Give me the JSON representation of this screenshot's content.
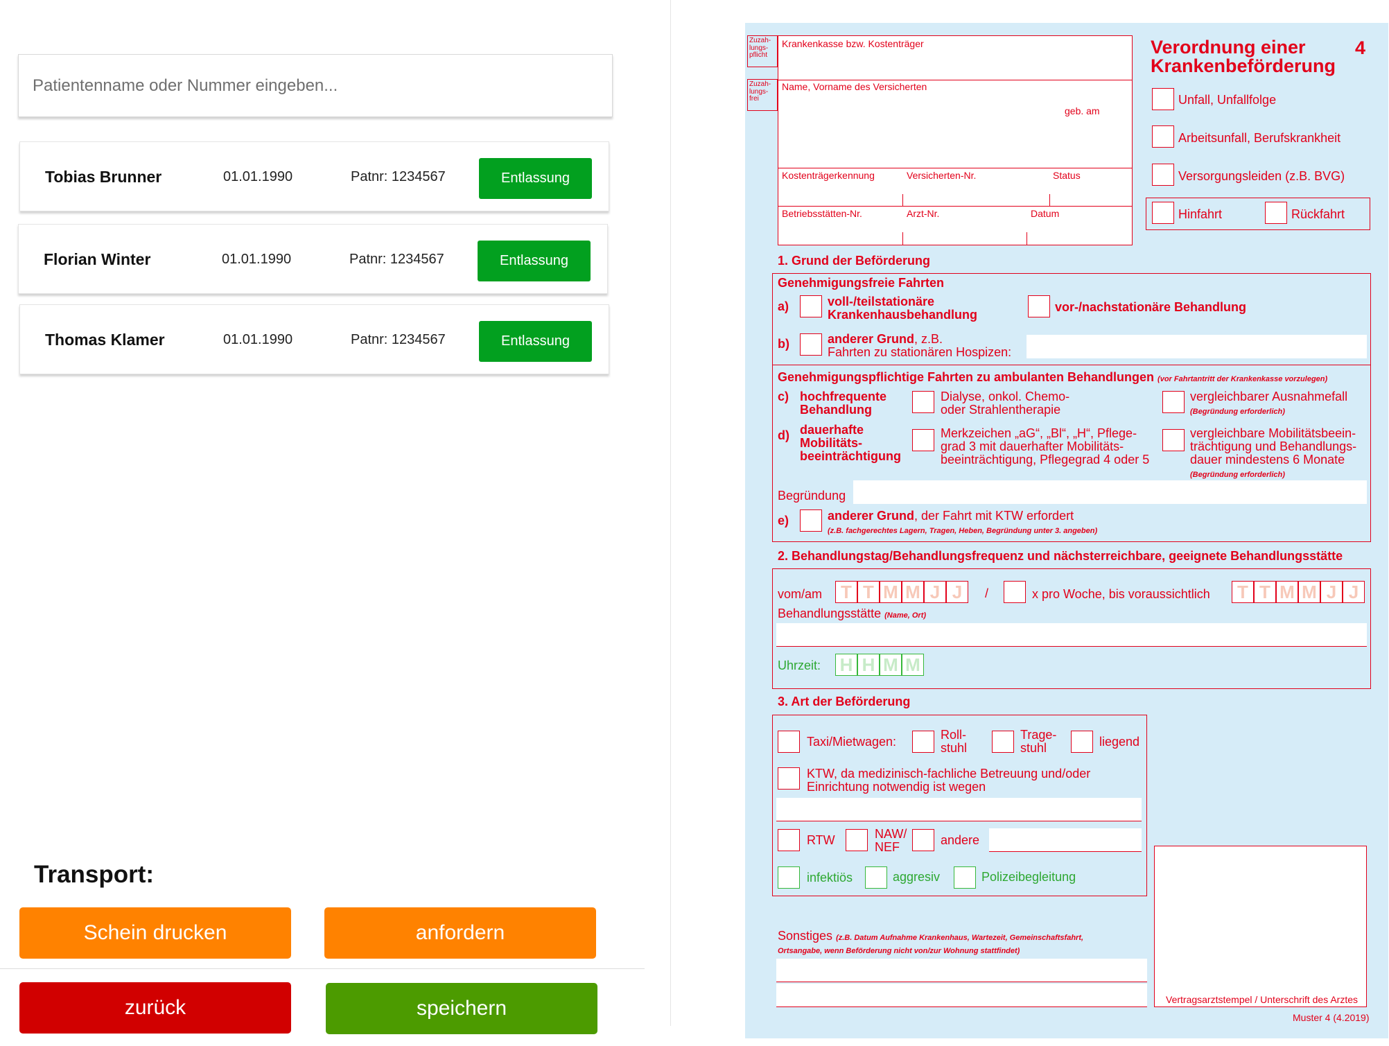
{
  "search": {
    "placeholder": "Patientenname oder Nummer eingeben..."
  },
  "patients": [
    {
      "name": "Tobias Brunner",
      "dob": "01.01.1990",
      "patnr": "Patnr: 1234567",
      "action": "Entlassung"
    },
    {
      "name": "Florian Winter",
      "dob": "01.01.1990",
      "patnr": "Patnr: 1234567",
      "action": "Entlassung"
    },
    {
      "name": "Thomas Klamer",
      "dob": "01.01.1990",
      "patnr": "Patnr: 1234567",
      "action": "Entlassung"
    }
  ],
  "transport": {
    "title": "Transport:",
    "print_label": "Schein drucken",
    "request_label": "anfordern",
    "back_label": "zurück",
    "save_label": "speichern"
  },
  "colors": {
    "green_button": "#02a01f",
    "orange": "#ff8200",
    "red": "#d10000",
    "save_green": "#4c9b00",
    "form_red": "#e2001a",
    "form_bg": "#d6ecf8"
  },
  "form": {
    "zuzahlungspflicht": [
      "Zuzah-",
      "lungs-",
      "pflicht"
    ],
    "zuzahlungsfrei": [
      "Zuzah-",
      "lungs-",
      "frei"
    ],
    "kasse": "Krankenkasse bzw. Kostenträger",
    "name": "Name, Vorname des Versicherten",
    "geb": "geb. am",
    "kostentraegerkennung": "Kostenträgerkennung",
    "versnr": "Versicherten-Nr.",
    "status": "Status",
    "bsnr": "Betriebsstätten-Nr.",
    "arztnr": "Arzt-Nr.",
    "datum": "Datum",
    "title1": "Verordnung einer",
    "title2": "Krankenbeförderung",
    "number": "4",
    "unfall": "Unfall, Unfallfolge",
    "arbeitsunfall": "Arbeitsunfall, Berufskrankheit",
    "versorgung": "Versorgungsleiden (z.B. BVG)",
    "hinfahrt": "Hinfahrt",
    "rueckfahrt": "Rückfahrt",
    "s1": "1. Grund der Beförderung",
    "genfrei": "Genehmigungsfreie Fahrten",
    "a": "a)",
    "a1": "voll-/teilstationäre",
    "a2": "Krankenhausbehandlung",
    "vornach": "vor-/nachstationäre Behandlung",
    "b": "b)",
    "b1": "anderer Grund",
    "b1b": ", z.B.",
    "b2": "Fahrten zu stationären Hospizen:",
    "genpfl": "Genehmigungspflichtige Fahrten zu ambulanten Behandlungen",
    "genpfl_note": "(vor Fahrtantritt der Krankenkasse vorzulegen)",
    "c": "c)",
    "c1": "hochfrequente",
    "c2": "Behandlung",
    "dia1": "Dialyse, onkol. Chemo-",
    "dia2": "oder Strahlentherapie",
    "verg1": "vergleichbarer Ausnahmefall",
    "verg_note": "(Begründung erforderlich)",
    "d": "d)",
    "d1": "dauerhafte",
    "d2": "Mobilitäts-",
    "d3": "beeinträchtigung",
    "mz1": "Merkzeichen „aG“, „Bl“, „H“, Pflege-",
    "mz2": "grad 3 mit dauerhafter Mobilitäts-",
    "mz3": "beeinträchtigung, Pflegegrad 4 oder 5",
    "vm1": "vergleichbare Mobilitätsbeein-",
    "vm2": "trächtigung und Behandlungs-",
    "vm3": "dauer mindestens 6 Monate",
    "vm_note": "(Begründung erforderlich)",
    "begruendung": "Begründung",
    "e": "e)",
    "e1": "anderer Grund",
    "e1b": ", der Fahrt mit KTW erfordert",
    "e_note": "(z.B. fachgerechtes Lagern, Tragen, Heben, Begründung unter 3. angeben)",
    "s2": "2. Behandlungstag/Behandlungsfrequenz und nächsterreichbare, geeignete Behandlungsstätte",
    "vomam": "vom/am",
    "date_digits": [
      "T",
      "T",
      "M",
      "M",
      "J",
      "J"
    ],
    "slash": "/",
    "xprowoche": "x pro Woche,  bis voraussichtlich",
    "behst": "Behandlungsstätte",
    "behst_note": "(Name, Ort)",
    "uhrzeit": "Uhrzeit:",
    "time_digits": [
      "H",
      "H",
      "M",
      "M"
    ],
    "s3": "3. Art der Beförderung",
    "taxi": "Taxi/Mietwagen:",
    "roll1": "Roll-",
    "roll2": "stuhl",
    "trage1": "Trage-",
    "trage2": "stuhl",
    "liegend": "liegend",
    "ktw1": "KTW, da medizinisch-fachliche Betreuung und/oder",
    "ktw2": "Einrichtung notwendig ist wegen",
    "rtw": "RTW",
    "naw1": "NAW/",
    "naw2": "NEF",
    "andere": "andere",
    "infektioes": "infektiös",
    "aggresiv": "aggresiv",
    "polizei": "Polizeibegleitung",
    "sonstiges": "Sonstiges",
    "sonst_note1": "(z.B. Datum Aufnahme Krankenhaus, Wartezeit, Gemeinschaftsfahrt,",
    "sonst_note2": "Ortsangabe, wenn Beförderung nicht von/zur Wohnung stattfindet)",
    "stempel": "Vertragsarztstempel / Unterschrift des Arztes",
    "muster": "Muster 4 (4.2019)"
  }
}
